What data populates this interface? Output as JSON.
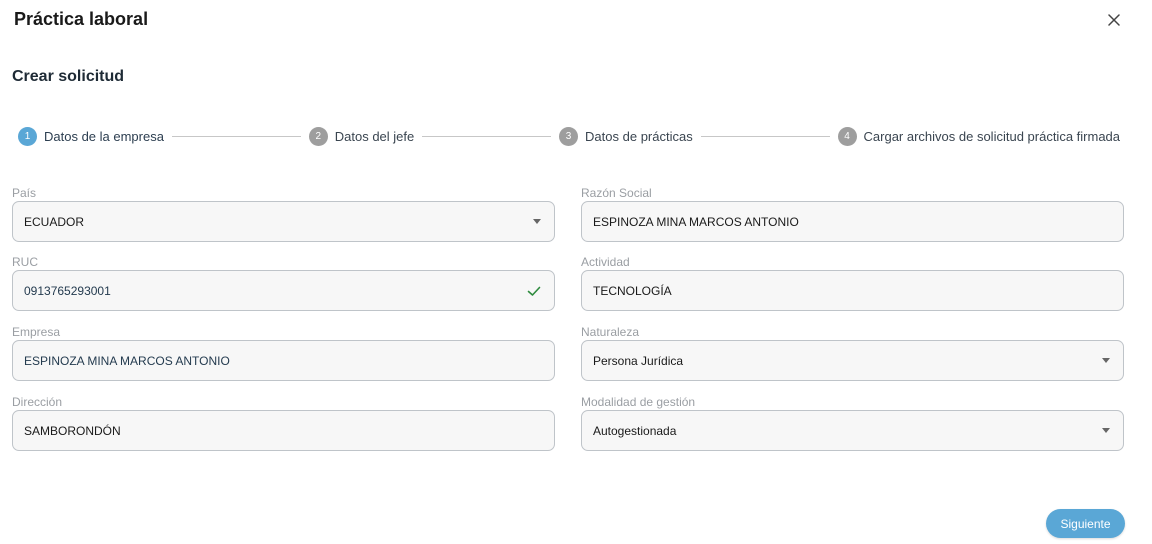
{
  "dialog": {
    "title": "Práctica laboral",
    "subtitle": "Crear solicitud"
  },
  "stepper": {
    "steps": [
      {
        "number": "1",
        "label": "Datos de la empresa",
        "active": true
      },
      {
        "number": "2",
        "label": "Datos del jefe",
        "active": false
      },
      {
        "number": "3",
        "label": "Datos de prácticas",
        "active": false
      },
      {
        "number": "4",
        "label": "Cargar archivos de solicitud práctica firmada",
        "active": false
      }
    ]
  },
  "form": {
    "pais": {
      "label": "País",
      "value": "ECUADOR"
    },
    "razon_social": {
      "label": "Razón Social",
      "value": "ESPINOZA MINA MARCOS ANTONIO"
    },
    "ruc": {
      "label": "RUC",
      "value": "0913765293001"
    },
    "actividad": {
      "label": "Actividad",
      "value": "TECNOLOGÍA"
    },
    "empresa": {
      "label": "Empresa",
      "value": "ESPINOZA MINA MARCOS ANTONIO"
    },
    "naturaleza": {
      "label": "Naturaleza",
      "value": "Persona Jurídica"
    },
    "direccion": {
      "label": "Dirección",
      "value": "SAMBORONDÓN"
    },
    "modalidad": {
      "label": "Modalidad de gestión",
      "value": "Autogestionada"
    }
  },
  "actions": {
    "next_label": "Siguiente"
  },
  "colors": {
    "accent": "#5aa7d6",
    "valid": "#2e8b3e",
    "inactive_step": "#9e9e9e"
  },
  "icons": {
    "close": "close-icon",
    "dropdown": "caret-down-icon",
    "valid": "check-icon"
  }
}
